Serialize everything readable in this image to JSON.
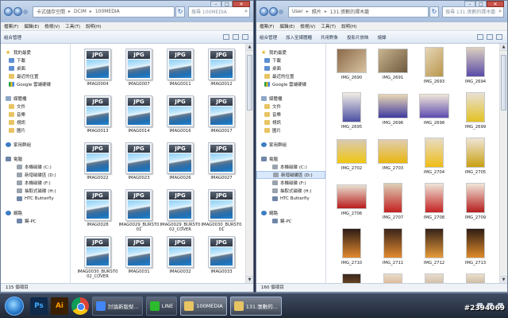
{
  "left": {
    "address": [
      "卡式儲存空間",
      "DCIM",
      "100MEDIA"
    ],
    "search_placeholder": "搜尋 100MEDIA",
    "menu": [
      "檔案(F)",
      "編輯(E)",
      "檢視(V)",
      "工具(T)",
      "說明(H)"
    ],
    "toolbar": [
      "組合管理"
    ],
    "status": "115 個項目",
    "items": [
      "IMAG0004",
      "IMAG0007",
      "IMAG0011",
      "IMAG0012",
      "IMAG0013",
      "IMAG0014",
      "IMAG0016",
      "IMAG0017",
      "IMAG0022",
      "IMAG0023",
      "IMAG0026",
      "IMAG0027",
      "IMAG0028",
      "IMAG0029_BURST001",
      "IMAG0029_BURST002_COVER",
      "IMAG0030_BURST001",
      "IMAG0030_BURST002_COVER",
      "IMAG0031",
      "IMAG0032",
      "IMAG0033",
      "",
      "",
      "",
      ""
    ]
  },
  "right": {
    "address": [
      "User",
      "照片",
      "131.張數的擇木籠"
    ],
    "search_placeholder": "搜尋 131.張數的擇木籠",
    "menu": [
      "檔案(F)",
      "編輯(E)",
      "檢視(V)",
      "工具(T)",
      "說明(H)"
    ],
    "toolbar": [
      "組合管理",
      "加入至媒體櫃",
      "共用對象",
      "投影片放映",
      "燒錄"
    ],
    "status": "160 個項目",
    "items": [
      "IMG_2690",
      "IMG_2691",
      "IMG_2693",
      "IMG_2694",
      "IMG_2695",
      "IMG_2696",
      "IMG_2698",
      "IMG_2699",
      "IMG_2702",
      "IMG_2703",
      "IMG_2704",
      "IMG_2705",
      "IMG_2706",
      "IMG_2707",
      "IMG_2708",
      "IMG_2709",
      "IMG_2710",
      "IMG_2711",
      "IMG_2712",
      "IMG_2713",
      "",
      "",
      "",
      ""
    ]
  },
  "nav": {
    "favorites": "我的最愛",
    "fav_items": [
      "下載",
      "桌面",
      "最近的位置",
      "Google 雲端硬碟"
    ],
    "libraries": "媒體櫃",
    "lib_items": [
      "文件",
      "音樂",
      "視訊",
      "圖片"
    ],
    "homegroup": "家用群組",
    "computer": "電腦",
    "drives": [
      "本機磁碟 (C:)",
      "新增磁碟區 (D:)",
      "本機磁碟 (F:)",
      "抽取式磁碟 (H:)",
      "HTC Butterfly"
    ],
    "network": "網路",
    "net_items": [
      "鍵-PC"
    ]
  },
  "taskbar": {
    "tasks": [
      "討論新版梨...",
      "LINE",
      "100MEDIA",
      "131.張數的..."
    ],
    "watermark": "#2394069"
  },
  "colors": {
    "accent": "#2d7fd0",
    "selection": "#d9e8fb",
    "taskbar": "#1f2836"
  }
}
